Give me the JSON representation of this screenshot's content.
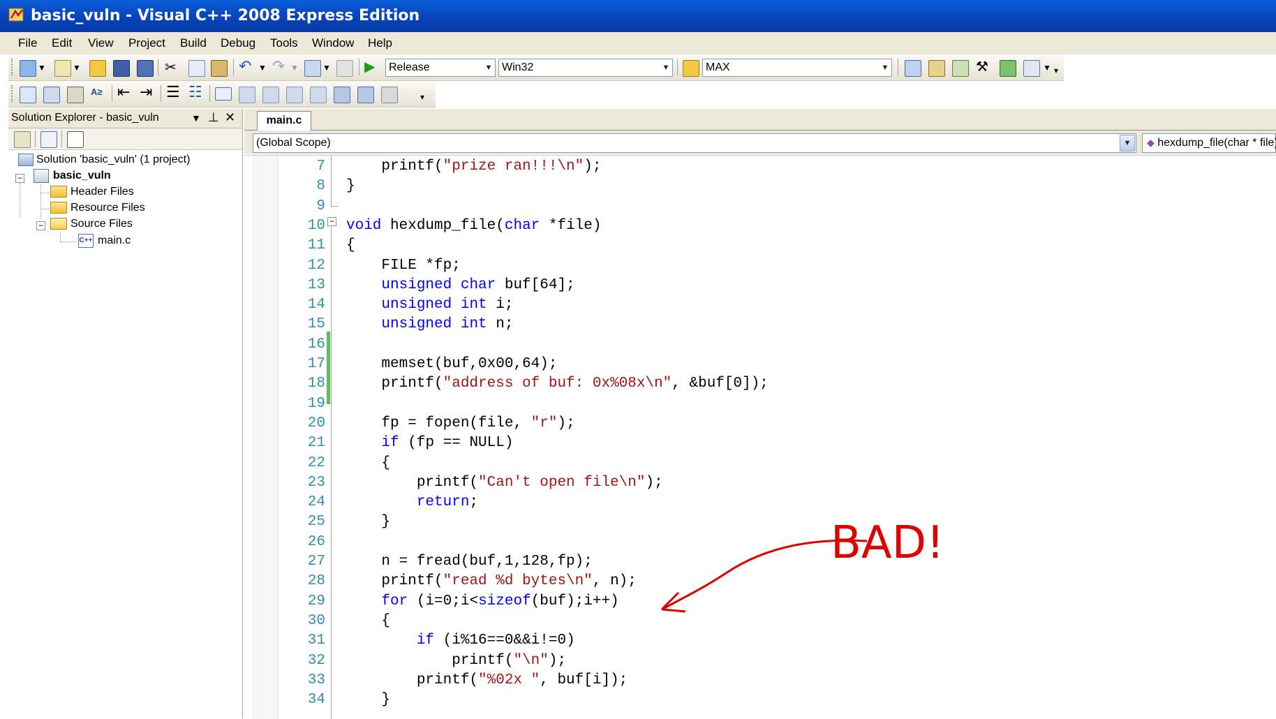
{
  "window": {
    "title": "basic_vuln - Visual C++ 2008 Express Edition"
  },
  "menu": [
    "File",
    "Edit",
    "View",
    "Project",
    "Build",
    "Debug",
    "Tools",
    "Window",
    "Help"
  ],
  "toolbar": {
    "config": "Release",
    "platform": "Win32",
    "find": "MAX"
  },
  "solution_explorer": {
    "title": "Solution Explorer - basic_vuln",
    "pin_glyph": "▾ ⊥",
    "close_glyph": "✕",
    "tree": [
      "Solution 'basic_vuln' (1 project)",
      "basic_vuln",
      "Header Files",
      "Resource Files",
      "Source Files",
      "main.c"
    ]
  },
  "editor": {
    "tab": "main.c",
    "scope": "(Global Scope)",
    "member": "hexdump_file(char * file)",
    "lines": [
      {
        "n": "7",
        "segs": [
          {
            "t": "    printf("
          },
          {
            "t": "\"prize ran!!!\\n\"",
            "c": "str"
          },
          {
            "t": ");"
          }
        ]
      },
      {
        "n": "8",
        "segs": [
          {
            "t": "}"
          }
        ]
      },
      {
        "n": "9",
        "segs": []
      },
      {
        "n": "10",
        "segs": [
          {
            "t": "void",
            "c": "kw"
          },
          {
            "t": " hexdump_file("
          },
          {
            "t": "char",
            "c": "kw"
          },
          {
            "t": " *file)"
          }
        ]
      },
      {
        "n": "11",
        "segs": [
          {
            "t": "{"
          }
        ]
      },
      {
        "n": "12",
        "segs": [
          {
            "t": "    FILE *fp;"
          }
        ]
      },
      {
        "n": "13",
        "segs": [
          {
            "t": "    "
          },
          {
            "t": "unsigned char",
            "c": "kw"
          },
          {
            "t": " buf[64];"
          }
        ]
      },
      {
        "n": "14",
        "segs": [
          {
            "t": "    "
          },
          {
            "t": "unsigned int",
            "c": "kw"
          },
          {
            "t": " i;"
          }
        ]
      },
      {
        "n": "15",
        "segs": [
          {
            "t": "    "
          },
          {
            "t": "unsigned int",
            "c": "kw"
          },
          {
            "t": " n;"
          }
        ]
      },
      {
        "n": "16",
        "segs": []
      },
      {
        "n": "17",
        "segs": [
          {
            "t": "    memset(buf,0x00,64);"
          }
        ]
      },
      {
        "n": "18",
        "segs": [
          {
            "t": "    printf("
          },
          {
            "t": "\"address of buf: 0x%08x\\n\"",
            "c": "str"
          },
          {
            "t": ", &buf[0]);"
          }
        ]
      },
      {
        "n": "19",
        "segs": []
      },
      {
        "n": "20",
        "segs": [
          {
            "t": "    fp = fopen(file, "
          },
          {
            "t": "\"r\"",
            "c": "str"
          },
          {
            "t": ");"
          }
        ]
      },
      {
        "n": "21",
        "segs": [
          {
            "t": "    "
          },
          {
            "t": "if",
            "c": "kw"
          },
          {
            "t": " (fp == NULL)"
          }
        ]
      },
      {
        "n": "22",
        "segs": [
          {
            "t": "    {"
          }
        ]
      },
      {
        "n": "23",
        "segs": [
          {
            "t": "        printf("
          },
          {
            "t": "\"Can't open file\\n\"",
            "c": "str"
          },
          {
            "t": ");"
          }
        ]
      },
      {
        "n": "24",
        "segs": [
          {
            "t": "        "
          },
          {
            "t": "return",
            "c": "kw"
          },
          {
            "t": ";"
          }
        ]
      },
      {
        "n": "25",
        "segs": [
          {
            "t": "    }"
          }
        ]
      },
      {
        "n": "26",
        "segs": []
      },
      {
        "n": "27",
        "segs": [
          {
            "t": "    n = fread(buf,1,128,fp);"
          }
        ]
      },
      {
        "n": "28",
        "segs": [
          {
            "t": "    printf("
          },
          {
            "t": "\"read %d bytes\\n\"",
            "c": "str"
          },
          {
            "t": ", n);"
          }
        ]
      },
      {
        "n": "29",
        "segs": [
          {
            "t": "    "
          },
          {
            "t": "for",
            "c": "kw"
          },
          {
            "t": " (i=0;i<"
          },
          {
            "t": "sizeof",
            "c": "kw"
          },
          {
            "t": "(buf);i++)"
          }
        ]
      },
      {
        "n": "30",
        "segs": [
          {
            "t": "    {"
          }
        ]
      },
      {
        "n": "31",
        "segs": [
          {
            "t": "        "
          },
          {
            "t": "if",
            "c": "kw"
          },
          {
            "t": " (i%16==0&&i!=0)"
          }
        ]
      },
      {
        "n": "32",
        "segs": [
          {
            "t": "            printf("
          },
          {
            "t": "\"\\n\"",
            "c": "str"
          },
          {
            "t": ");"
          }
        ]
      },
      {
        "n": "33",
        "segs": [
          {
            "t": "        printf("
          },
          {
            "t": "\"%02x \"",
            "c": "str"
          },
          {
            "t": ", buf[i]);"
          }
        ]
      },
      {
        "n": "34",
        "segs": [
          {
            "t": "    }"
          }
        ]
      }
    ]
  },
  "annotation": {
    "text": "BAD!",
    "color": "#e00000"
  },
  "colors": {
    "keyword": "#0000ff",
    "string": "#a31515",
    "line_number": "#2b91af",
    "title_bar": "#0a5fd8"
  }
}
